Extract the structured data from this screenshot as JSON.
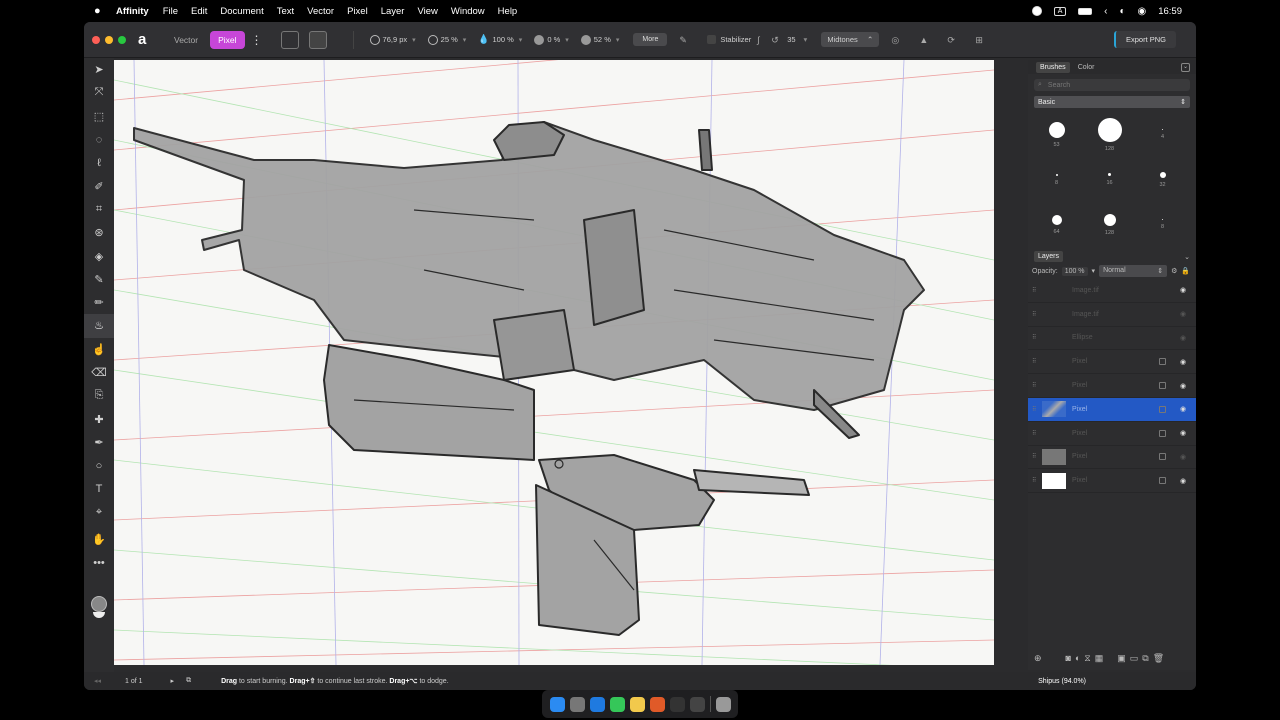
{
  "menubar": {
    "app_name": "Affinity",
    "menus": [
      "File",
      "Edit",
      "Document",
      "Text",
      "Vector",
      "Pixel",
      "Layer",
      "View",
      "Window",
      "Help"
    ],
    "input_badge": "A",
    "clock": "16:59"
  },
  "toolbar": {
    "personas": {
      "vector": "Vector",
      "pixel": "Pixel"
    },
    "brush_width": "76,9 px",
    "opacity": "25 %",
    "flow": "100 %",
    "hardness": "0 %",
    "exposure": "52 %",
    "more_label": "More",
    "stabilizer_label": "Stabilizer",
    "stabilizer_value": "35",
    "range_mode": "Midtones",
    "export_label": "Export PNG",
    "accent_color": "#c746d8"
  },
  "brushes_panel": {
    "tabs": [
      "Brushes",
      "Color"
    ],
    "search_placeholder": "Search",
    "category": "Basic",
    "brushes": [
      {
        "size_label": "53",
        "preview": 16
      },
      {
        "size_label": "128",
        "preview": 24
      },
      {
        "size_label": "4",
        "preview": 1
      },
      {
        "size_label": "8",
        "preview": 2
      },
      {
        "size_label": "16",
        "preview": 3
      },
      {
        "size_label": "32",
        "preview": 6
      },
      {
        "size_label": "64",
        "preview": 10
      },
      {
        "size_label": "128",
        "preview": 12
      },
      {
        "size_label": "8",
        "preview": 1
      }
    ]
  },
  "layers_panel": {
    "title": "Layers",
    "opacity_label": "Opacity:",
    "opacity_value": "100 %",
    "blend_mode": "Normal",
    "layers": [
      {
        "name": "Image.tif",
        "selected": false,
        "visible": true,
        "thumb": "none"
      },
      {
        "name": "Image.tif",
        "selected": false,
        "visible": false,
        "thumb": "none"
      },
      {
        "name": "Ellipse",
        "selected": false,
        "visible": false,
        "thumb": "none"
      },
      {
        "name": "Pixel",
        "selected": false,
        "visible": true,
        "thumb": "none"
      },
      {
        "name": "Pixel",
        "selected": false,
        "visible": true,
        "thumb": "none"
      },
      {
        "name": "Pixel",
        "selected": true,
        "visible": true,
        "thumb": "ship"
      },
      {
        "name": "Pixel",
        "selected": false,
        "visible": true,
        "thumb": "none"
      },
      {
        "name": "Pixel",
        "selected": false,
        "visible": false,
        "thumb": "grey"
      },
      {
        "name": "Pixel",
        "selected": false,
        "visible": true,
        "thumb": "white"
      }
    ]
  },
  "statusbar": {
    "pages": "1 of 1",
    "hint_drag": "Drag",
    "hint_1": " to start burning. ",
    "hint_drag2": "Drag+⇧",
    "hint_2": " to continue last stroke. ",
    "hint_drag3": "Drag+⌥",
    "hint_3": " to dodge.",
    "document": "Shipus (94.0%)"
  }
}
